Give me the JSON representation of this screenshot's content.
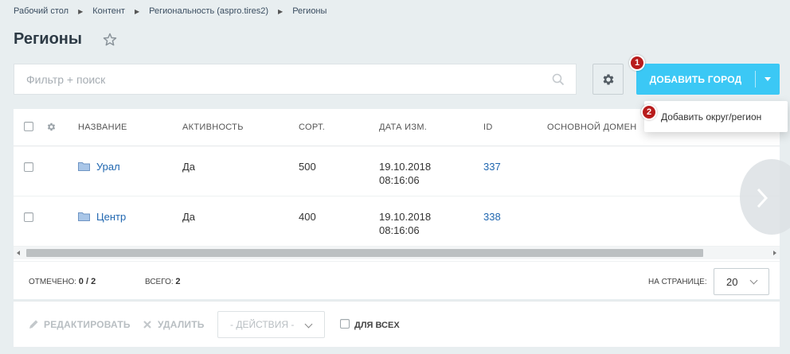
{
  "breadcrumbs": [
    "Рабочий стол",
    "Контент",
    "Региональность (aspro.tires2)",
    "Регионы"
  ],
  "page": {
    "title": "Регионы"
  },
  "filter": {
    "placeholder": "Фильтр + поиск",
    "value": ""
  },
  "toolbar": {
    "add_label": "ДОБАВИТЬ ГОРОД"
  },
  "badges": {
    "add": "1",
    "menu": "2"
  },
  "menu": {
    "item": "Добавить округ/регион"
  },
  "table": {
    "headers": [
      "НАЗВАНИЕ",
      "АКТИВНОСТЬ",
      "СОРТ.",
      "ДАТА ИЗМ.",
      "ID",
      "ОСНОВНОЙ ДОМЕН"
    ],
    "rows": [
      {
        "name": "Урал",
        "active": "Да",
        "sort": "500",
        "date": "19.10.2018",
        "time": "08:16:06",
        "id": "337"
      },
      {
        "name": "Центр",
        "active": "Да",
        "sort": "400",
        "date": "19.10.2018",
        "time": "08:16:06",
        "id": "338"
      }
    ]
  },
  "footer": {
    "checked_label": "ОТМЕЧЕНО:",
    "checked_value": "0 / 2",
    "total_label": "ВСЕГО:",
    "total_value": "2",
    "per_page_label": "НА СТРАНИЦЕ:",
    "per_page_value": "20"
  },
  "actions": {
    "edit": "РЕДАКТИРОВАТЬ",
    "delete": "УДАЛИТЬ",
    "select": "- ДЕЙСТВИЯ -",
    "for_all": "ДЛЯ ВСЕХ"
  },
  "colors": {
    "accent": "#3bc8f5",
    "link": "#2067b0",
    "badge": "#b81c1c"
  }
}
